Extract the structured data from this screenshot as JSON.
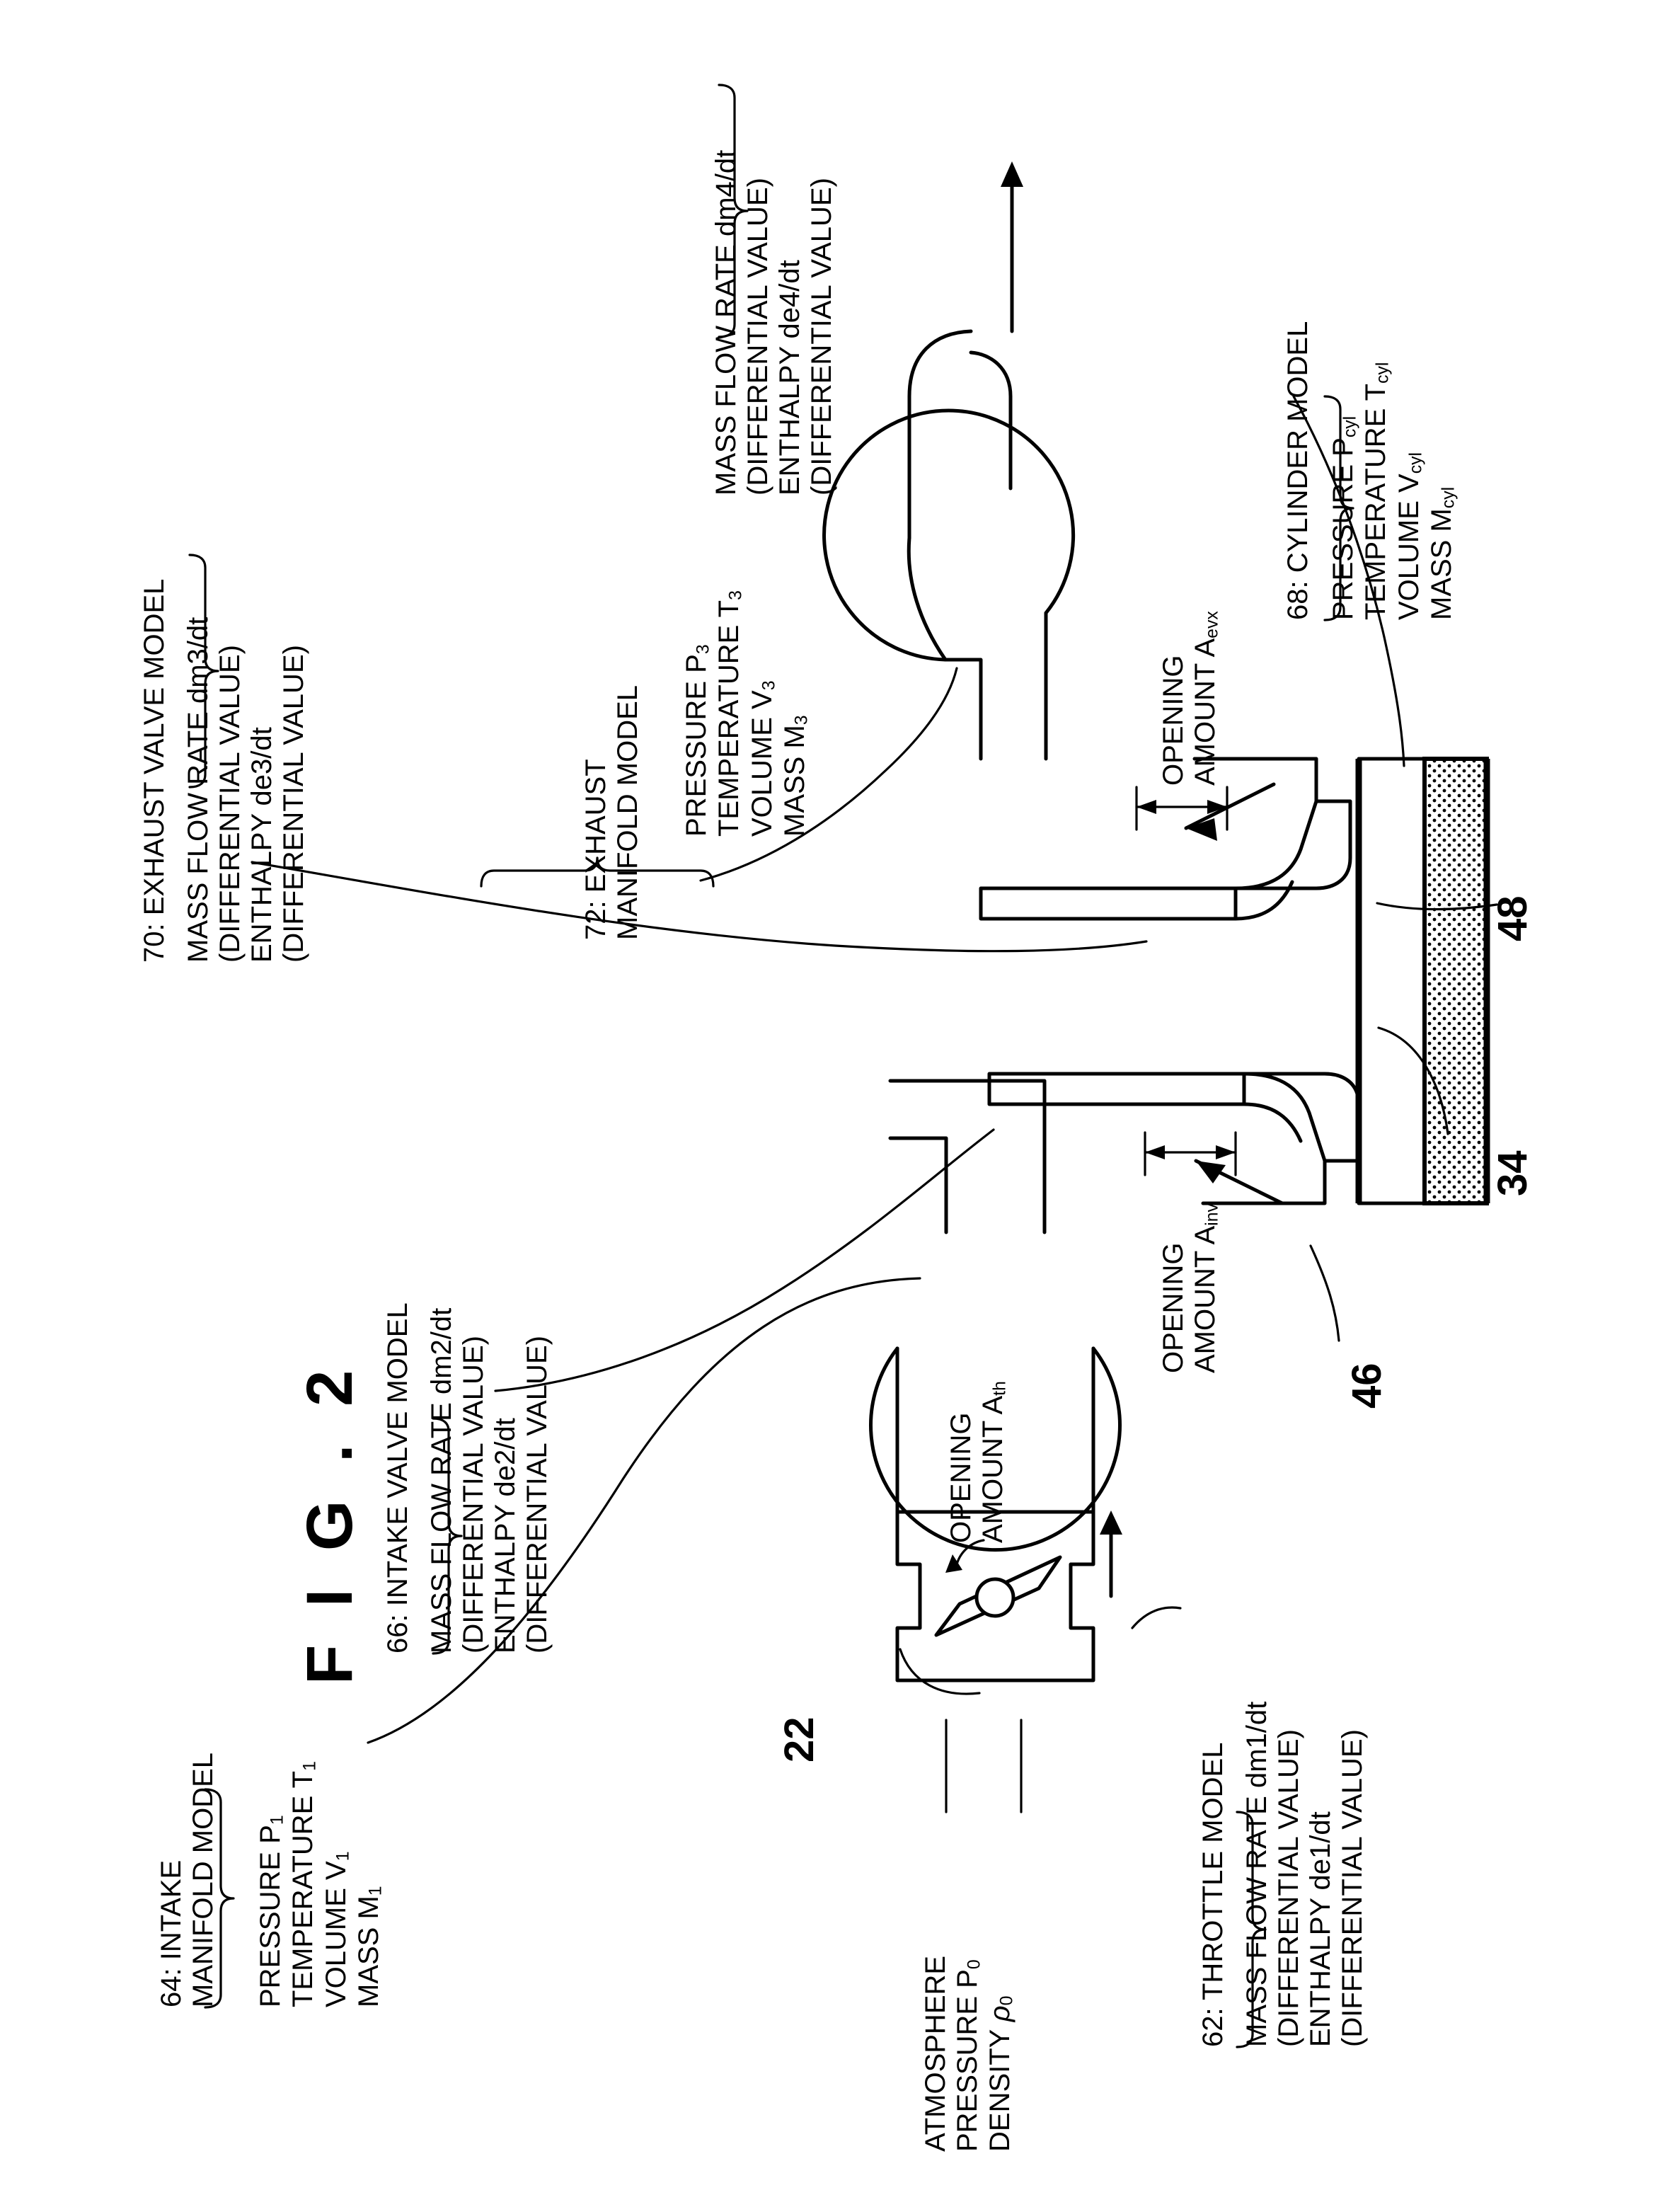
{
  "figure": {
    "title": "F I G . 2"
  },
  "labels": {
    "exhaust_valve_model": {
      "heading": "70: EXHAUST VALVE MODEL",
      "lines": [
        "MASS FLOW RATE dm3/dt",
        "(DIFFERENTIAL VALUE)",
        "ENTHALPY de3/dt",
        "(DIFFERENTIAL VALUE)"
      ]
    },
    "exhaust_manifold_model": {
      "heading_line1": "72: EXHAUST",
      "heading_line2": "MANIFOLD MODEL",
      "lines": [
        "PRESSURE P3",
        "TEMPERATURE T3",
        "VOLUME V3",
        "MASS M3"
      ]
    },
    "cylinder_model": {
      "heading": "68: CYLINDER MODEL",
      "lines": [
        "PRESSURE Pcyl",
        "TEMPERATURE Tcyl",
        "VOLUME Vcyl",
        "MASS Mcyl"
      ],
      "flow_lines": [
        "MASS FLOW RATE dm4/dt",
        "(DIFFERENTIAL VALUE)",
        "ENTHALPY de4/dt",
        "(DIFFERENTIAL VALUE)"
      ]
    },
    "intake_valve_model": {
      "heading": "66: INTAKE VALVE MODEL",
      "lines": [
        "MASS FLOW RATE dm2/dt",
        "(DIFFERENTIAL VALUE)",
        "ENTHALPY de2/dt",
        "(DIFFERENTIAL VALUE)"
      ]
    },
    "intake_manifold_model": {
      "heading_line1": "64: INTAKE",
      "heading_line2": "MANIFOLD MODEL",
      "lines": [
        "PRESSURE P1",
        "TEMPERATURE T1",
        "VOLUME V1",
        "MASS M1"
      ]
    },
    "throttle_model": {
      "heading": "62: THROTTLE MODEL",
      "lines": [
        "MASS FLOW RATE dm1/dt",
        "(DIFFERENTIAL VALUE)",
        "ENTHALPY de1/dt",
        "(DIFFERENTIAL VALUE)"
      ]
    },
    "atmosphere": {
      "lines": [
        "ATMOSPHERE",
        "PRESSURE P0",
        "DENSITY ρ0"
      ]
    },
    "opening_amount_throttle": {
      "line1": "OPENING",
      "line2": "AMOUNT Ath"
    },
    "opening_amount_intake_valve": {
      "line1": "OPENING",
      "line2": "AMOUNT Ainv"
    },
    "opening_amount_exhaust_valve": {
      "line1": "OPENING",
      "line2": "AMOUNT Aevx"
    }
  },
  "reference_numerals": {
    "throttle": "22",
    "intake_valve": "46",
    "exhaust_valve": "48",
    "piston": "34"
  }
}
